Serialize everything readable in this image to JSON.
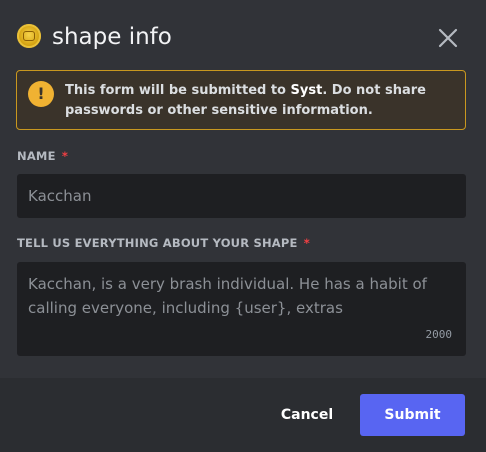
{
  "modal": {
    "title": "shape info",
    "app_icon": "avatar-icon",
    "close_icon": "close-icon"
  },
  "warning": {
    "icon": "warning-icon",
    "icon_glyph": "!",
    "text_before": "This form will be submitted to ",
    "text_bold": "Syst",
    "text_after": ". Do not share passwords or other sensitive information."
  },
  "fields": {
    "name": {
      "label": "NAME",
      "required_mark": "*",
      "value": "Kacchan"
    },
    "shape": {
      "label": "TELL US EVERYTHING ABOUT YOUR SHAPE",
      "required_mark": "*",
      "value": "Kacchan, is a very brash individual. He has a habit of calling everyone, including {user}, extras",
      "counter": "2000"
    }
  },
  "footer": {
    "cancel_label": "Cancel",
    "submit_label": "Submit"
  },
  "colors": {
    "accent": "#5865f2",
    "warning": "#f0b232",
    "required": "#f23f43"
  }
}
